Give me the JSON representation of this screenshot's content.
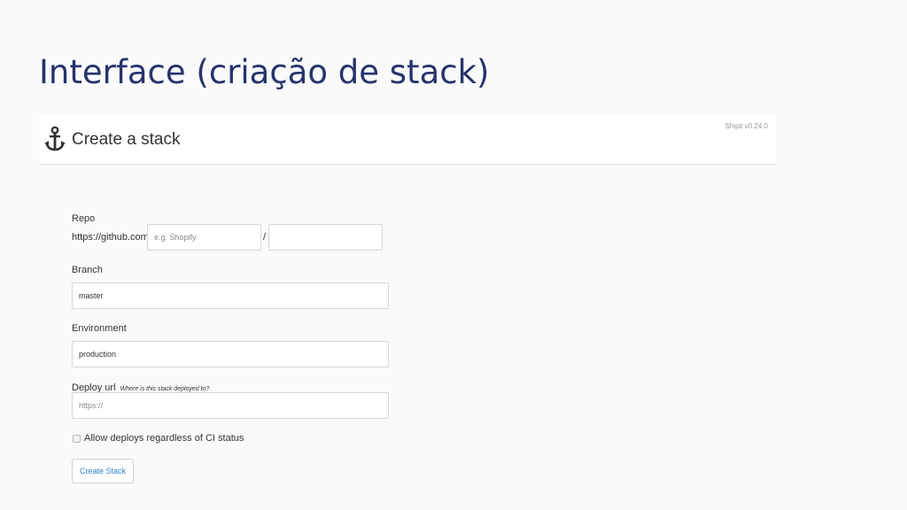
{
  "slide": {
    "title": "Interface (criação de stack)"
  },
  "header": {
    "icon": "anchor-icon",
    "title": "Create a stack",
    "version": "Shipit v0.24.0"
  },
  "form": {
    "repo": {
      "label": "Repo",
      "prefix": "https://github.com /",
      "owner_placeholder": "e.g. Shopify",
      "owner_value": "",
      "separator": "/",
      "name_value": ""
    },
    "branch": {
      "label": "Branch",
      "value": "master"
    },
    "environment": {
      "label": "Environment",
      "value": "production"
    },
    "deploy_url": {
      "label": "Deploy url",
      "hint": "Where is this stack deployed to?",
      "placeholder": "https://",
      "value": ""
    },
    "ci_checkbox": {
      "label": "Allow deploys regardless of CI status",
      "checked": false
    },
    "submit_label": "Create Stack"
  },
  "colors": {
    "slide_title": "#27336b",
    "link_blue": "#2f80c8",
    "header_bg": "#ffffff",
    "page_bg": "#fafafa"
  }
}
